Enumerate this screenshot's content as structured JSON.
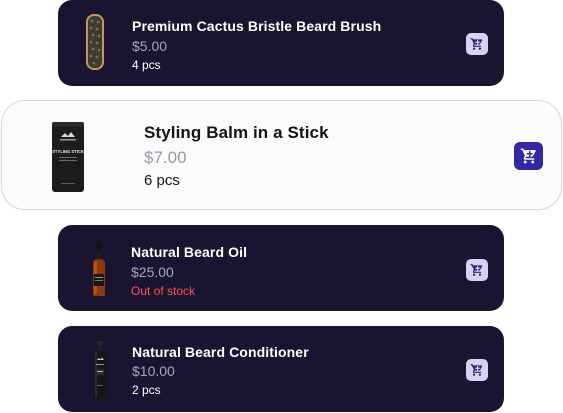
{
  "products": [
    {
      "name": "Premium Cactus Bristle Beard Brush",
      "price": "$5.00",
      "stock": "4 pcs",
      "icon": "cart-icon"
    },
    {
      "name": "Styling Balm in a Stick",
      "price": "$7.00",
      "stock": "6 pcs",
      "icon": "cart-icon",
      "product_label": "STYLING STICK"
    },
    {
      "name": "Natural Beard Oil",
      "price": "$25.00",
      "stock": "Out of stock",
      "icon": "cart-icon"
    },
    {
      "name": "Natural Beard Conditioner",
      "price": "$10.00",
      "stock": "2 pcs",
      "icon": "cart-icon"
    }
  ],
  "colors": {
    "card_dark": "#191531",
    "card_selected": "#fcfcfd",
    "accent": "#3528a6",
    "cart_button_pale": "#d5d2f3",
    "price_muted": "#a7a5b5",
    "out_of_stock": "#ff4d5e"
  }
}
